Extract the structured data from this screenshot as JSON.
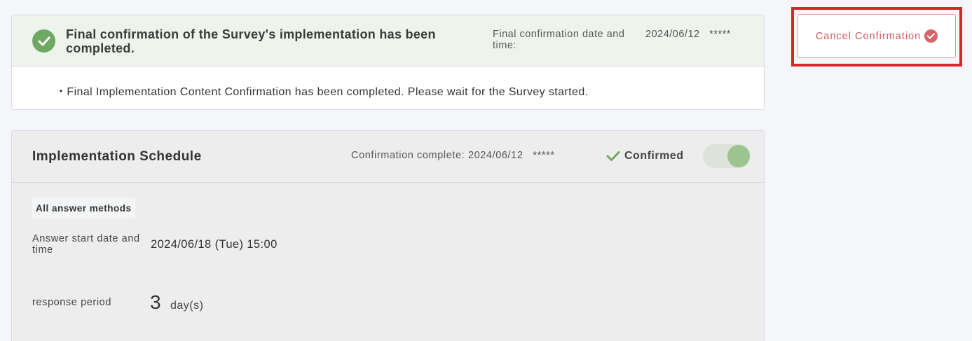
{
  "final_confirmation": {
    "title": "Final confirmation of the Survey's implementation has been completed.",
    "date_label": "Final confirmation date and time:",
    "date_value": "2024/06/12",
    "date_user": "*****",
    "message": "・Final Implementation Content Confirmation has been completed. Please wait for the Survey started.",
    "icon": "check-circle-icon",
    "accent_color": "#6fa862"
  },
  "cancel_button": {
    "label": "Cancel Confirmation",
    "icon": "check-circle-icon",
    "color": "#d05a61",
    "highlight_color": "#d9262e"
  },
  "schedule": {
    "title": "Implementation Schedule",
    "status_label": "Confirmation complete:",
    "status_date": "2024/06/12",
    "status_user": "*****",
    "confirmed_label": "Confirmed",
    "toggle_on": true,
    "methods_tag": "All answer methods",
    "answer_start_label": "Answer start date and time",
    "answer_start_value": "2024/06/18 (Tue) 15:00",
    "period_label": "response period",
    "period_value": "3",
    "period_unit": "day(s)"
  }
}
